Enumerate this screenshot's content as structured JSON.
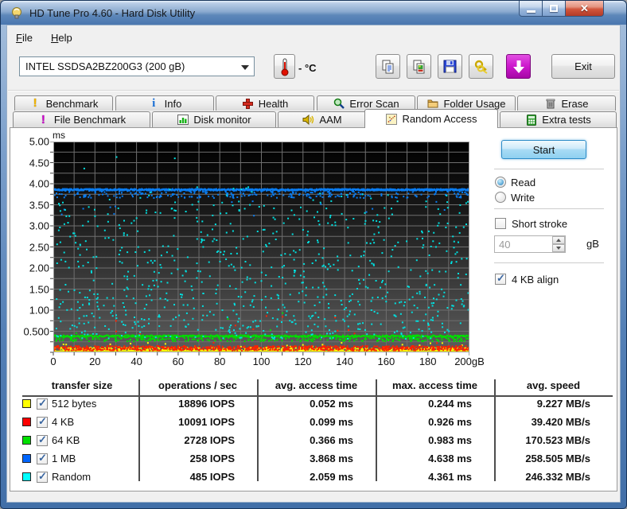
{
  "window": {
    "title": "HD Tune Pro 4.60 - Hard Disk Utility",
    "controls": {
      "minimize": "minimize",
      "maximize": "maximize",
      "close": "close"
    }
  },
  "menu": {
    "items": [
      {
        "label": "File"
      },
      {
        "label": "Help"
      }
    ]
  },
  "toolbar": {
    "drive_selector": "INTEL SSDSA2BZ200G3   (200 gB)",
    "temperature": "- °C",
    "buttons": [
      "copy-text",
      "copy-image",
      "save",
      "keys",
      "download"
    ],
    "exit_label": "Exit"
  },
  "tabs": {
    "row1": [
      {
        "label": "Benchmark",
        "icon": "excl_yellow"
      },
      {
        "label": "Info",
        "icon": "info"
      },
      {
        "label": "Health",
        "icon": "health"
      },
      {
        "label": "Error Scan",
        "icon": "errorscan"
      },
      {
        "label": "Folder Usage",
        "icon": "folder"
      },
      {
        "label": "Erase",
        "icon": "erase"
      }
    ],
    "row2": [
      {
        "label": "File Benchmark",
        "icon": "excl_magenta"
      },
      {
        "label": "Disk monitor",
        "icon": "diskmon"
      },
      {
        "label": "AAM",
        "icon": "aam"
      },
      {
        "label": "Random Access",
        "icon": "randomaccess",
        "active": true
      },
      {
        "label": "Extra tests",
        "icon": "extratests"
      }
    ],
    "active": "Random Access"
  },
  "controls": {
    "start_label": "Start",
    "read_label": "Read",
    "write_label": "Write",
    "read_selected": true,
    "write_selected": false,
    "short_stroke_label": "Short stroke",
    "short_stroke_checked": false,
    "stroke_value": "40",
    "stroke_unit": "gB",
    "align_label": "4 KB align",
    "align_checked": true
  },
  "chart_data": {
    "type": "scatter",
    "title": "Random access time vs disk position",
    "xlabel": "gB",
    "ylabel": "ms",
    "xlim": [
      0,
      200
    ],
    "ylim": [
      0,
      5
    ],
    "x_grid_step": 10,
    "y_grid_step": 0.25,
    "x_tick_labels": [
      "0",
      "20",
      "40",
      "60",
      "80",
      "100",
      "120",
      "140",
      "160",
      "180",
      "200gB"
    ],
    "y_tick_labels": [
      "5.00",
      "4.50",
      "4.00",
      "3.50",
      "3.00",
      "2.50",
      "2.00",
      "1.50",
      "1.00",
      "0.500"
    ],
    "grid": true,
    "plot_bg_top": "#000000",
    "plot_bg_bottom": "#5d5d5d",
    "grid_color": "#6f6f6f",
    "series": [
      {
        "name": "512 bytes",
        "color": "#ffff00",
        "dense_line": 0.03,
        "dense_passes": 1,
        "band": [
          0.035,
          0.13
        ],
        "band_count": 650,
        "outlier_band": [
          0.13,
          0.244
        ],
        "outlier_count": 25,
        "avg_ms": 0.052,
        "max_ms": 0.244
      },
      {
        "name": "4 KB",
        "color": "#ff2000",
        "band": [
          0.06,
          0.17
        ],
        "band_count": 760,
        "outlier_band": [
          0.17,
          0.926
        ],
        "outlier_count": 16,
        "avg_ms": 0.099,
        "max_ms": 0.926
      },
      {
        "name": "64 KB",
        "color": "#00dc00",
        "dense_line": 0.405,
        "dense_passes": 1,
        "band": [
          0.28,
          0.4
        ],
        "band_count": 380,
        "outlier_band": [
          0.45,
          0.983
        ],
        "outlier_count": 4,
        "avg_ms": 0.366,
        "max_ms": 0.983
      },
      {
        "name": "1 MB",
        "color": "#0a7cf0",
        "dense_line": 3.875,
        "dense_passes": 2,
        "band": [
          3.68,
          3.85
        ],
        "band_count": 260,
        "outlier_band": [
          3.25,
          3.68
        ],
        "outlier_count": 14,
        "avg_ms": 3.868,
        "max_ms": 4.638
      },
      {
        "name": "Random",
        "color": "#00e0e0",
        "band": [
          0.33,
          3.6
        ],
        "band_count": 640,
        "low_band": [
          0.33,
          1.4
        ],
        "low_count": 140,
        "high_band": [
          3.6,
          3.95
        ],
        "high_count": 22,
        "points": [
          [
            14.5,
            4.38
          ],
          [
            30,
            4.65
          ],
          [
            58,
            4.62
          ]
        ],
        "avg_ms": 2.059,
        "max_ms": 4.361
      }
    ]
  },
  "table": {
    "headers": [
      "transfer size",
      "operations / sec",
      "avg. access time",
      "max. access time",
      "avg. speed"
    ],
    "rows": [
      {
        "color": "#ffff00",
        "checked": true,
        "label": "512 bytes",
        "ops": "18896 IOPS",
        "avg": "0.052 ms",
        "max": "0.244 ms",
        "speed": "9.227 MB/s"
      },
      {
        "color": "#ff0000",
        "checked": true,
        "label": "4 KB",
        "ops": "10091 IOPS",
        "avg": "0.099 ms",
        "max": "0.926 ms",
        "speed": "39.420 MB/s"
      },
      {
        "color": "#00e000",
        "checked": true,
        "label": "64 KB",
        "ops": "2728 IOPS",
        "avg": "0.366 ms",
        "max": "0.983 ms",
        "speed": "170.523 MB/s"
      },
      {
        "color": "#0066ff",
        "checked": true,
        "label": "1 MB",
        "ops": "258 IOPS",
        "avg": "3.868 ms",
        "max": "4.638 ms",
        "speed": "258.505 MB/s"
      },
      {
        "color": "#00ffff",
        "checked": true,
        "label": "Random",
        "ops": "485 IOPS",
        "avg": "2.059 ms",
        "max": "4.361 ms",
        "speed": "246.332 MB/s"
      }
    ]
  }
}
